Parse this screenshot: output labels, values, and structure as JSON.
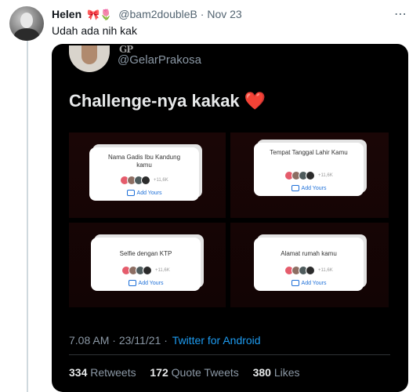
{
  "tweet": {
    "author_name": "Helen",
    "author_emojis": "🎀🌷",
    "handle": "@bam2doubleB",
    "separator": "·",
    "date": "Nov 23",
    "more_icon": "⋯",
    "text": "Udah ada nih kak"
  },
  "embedded": {
    "logo": "GP",
    "handle": "@GelarPrakosa",
    "title": "Challenge-nya kakak",
    "heart": "❤️",
    "cards": [
      {
        "label": "Nama Gadis Ibu Kandung kamu",
        "count": "+11,6K",
        "add": "Add Yours"
      },
      {
        "label": "Tempat Tanggal Lahir Kamu",
        "count": "+11,6K",
        "add": "Add Yours"
      },
      {
        "label": "Selfie dengan KTP",
        "count": "+11,6K",
        "add": "Add Yours"
      },
      {
        "label": "Alamat rumah kamu",
        "count": "+11,6K",
        "add": "Add Yours"
      }
    ],
    "time": "7.08 AM",
    "date": "23/11/21",
    "source": "Twitter for Android",
    "meta_separator": "·",
    "retweets": "334",
    "retweets_label": "Retweets",
    "quote_tweets": "172",
    "quote_tweets_label": "Quote Tweets",
    "likes": "380",
    "likes_label": "Likes"
  }
}
